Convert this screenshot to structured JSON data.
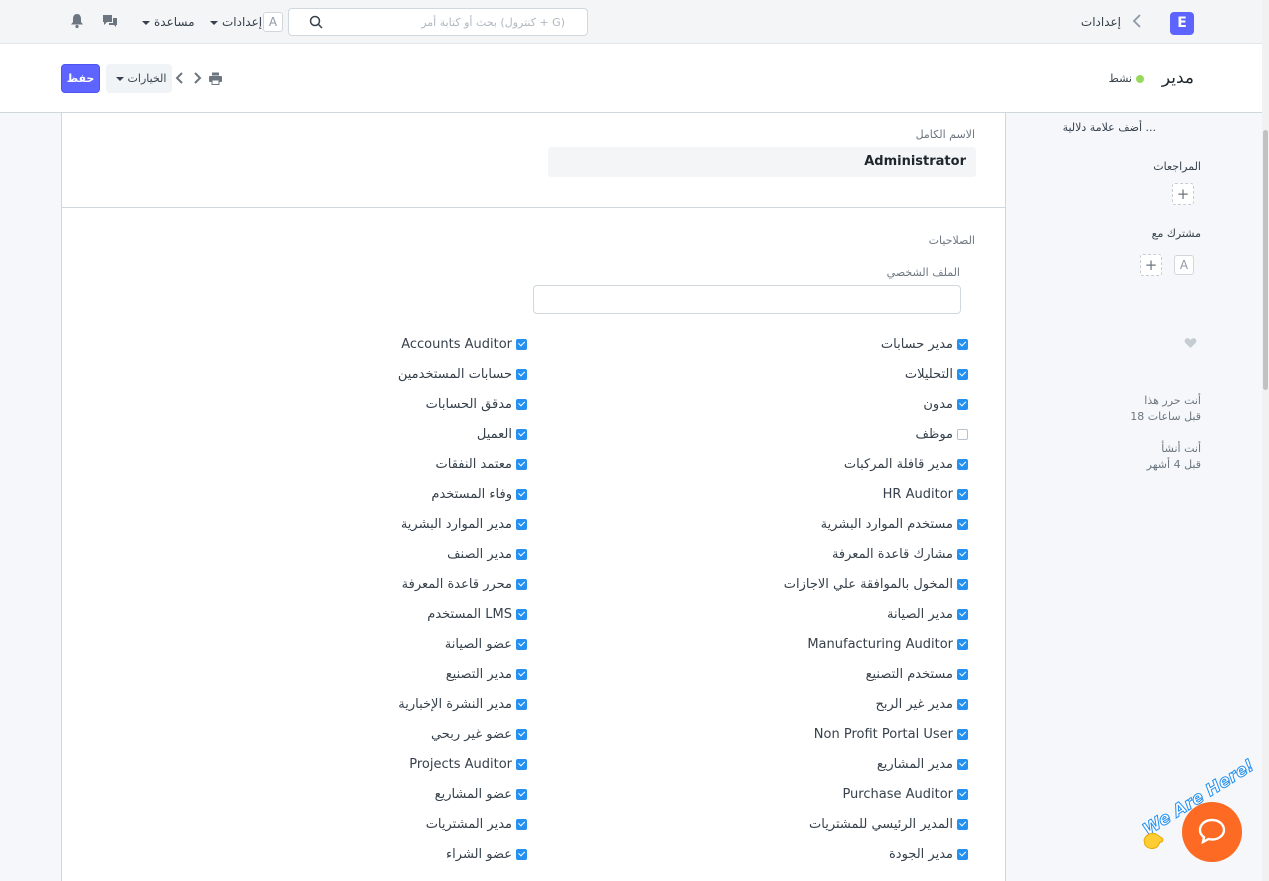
{
  "navbar": {
    "brand_letter": "E",
    "breadcrumb": "إعدادات",
    "search_placeholder": "بحث أو كتابة أمر (كنترول + G)",
    "avatar_letter": "A",
    "settings_menu": "إعدادات",
    "help_menu": "مساعدة"
  },
  "page": {
    "title": "مدير",
    "status": "نشط",
    "save_label": "حفظ",
    "options_label": "الخيارات"
  },
  "sidebar": {
    "add_tag": "أضف علامة دلالية ...",
    "reviews_label": "المراجعات",
    "shared_with_label": "مشترك مع",
    "shared_avatar": "A",
    "activity_1_line1": "أنت حرر هذا",
    "activity_1_line2": "18 قبل ساعات",
    "activity_2_line1": "أنت أنشأ",
    "activity_2_line2": "قبل 4 أشهر"
  },
  "form": {
    "full_name_label": "الاسم الكامل",
    "full_name_value": "Administrator",
    "permissions_section": "الصلاحيات",
    "profile_label": "الملف الشخصي"
  },
  "roles_right": [
    {
      "label": "مدير حسابات",
      "checked": true
    },
    {
      "label": "التحليلات",
      "checked": true
    },
    {
      "label": "مدون",
      "checked": true
    },
    {
      "label": "موظف",
      "checked": false
    },
    {
      "label": "مدير قافلة المركبات",
      "checked": true
    },
    {
      "label": "HR Auditor",
      "checked": true
    },
    {
      "label": "مستخدم الموارد البشرية",
      "checked": true
    },
    {
      "label": "مشارك قاعدة المعرفة",
      "checked": true
    },
    {
      "label": "المخول بالموافقة علي الاجازات",
      "checked": true
    },
    {
      "label": "مدير الصيانة",
      "checked": true
    },
    {
      "label": "Manufacturing Auditor",
      "checked": true
    },
    {
      "label": "مستخدم التصنيع",
      "checked": true
    },
    {
      "label": "مدير غير الربح",
      "checked": true
    },
    {
      "label": "Non Profit Portal User",
      "checked": true
    },
    {
      "label": "مدير المشاريع",
      "checked": true
    },
    {
      "label": "Purchase Auditor",
      "checked": true
    },
    {
      "label": "المدير الرئيسي للمشتريات",
      "checked": true
    },
    {
      "label": "مدير الجودة",
      "checked": true
    }
  ],
  "roles_left": [
    {
      "label": "Accounts Auditor",
      "checked": true
    },
    {
      "label": "حسابات المستخدمين",
      "checked": true
    },
    {
      "label": "مدقق الحسابات",
      "checked": true
    },
    {
      "label": "العميل",
      "checked": true
    },
    {
      "label": "معتمد النفقات",
      "checked": true
    },
    {
      "label": "وفاء المستخدم",
      "checked": true
    },
    {
      "label": "مدير الموارد البشرية",
      "checked": true
    },
    {
      "label": "مدير الصنف",
      "checked": true
    },
    {
      "label": "محرر قاعدة المعرفة",
      "checked": true
    },
    {
      "label": "LMS المستخدم",
      "checked": true
    },
    {
      "label": "عضو الصيانة",
      "checked": true
    },
    {
      "label": "مدير التصنيع",
      "checked": true
    },
    {
      "label": "مدير النشرة الإخبارية",
      "checked": true
    },
    {
      "label": "عضو غير ربحي",
      "checked": true
    },
    {
      "label": "Projects Auditor",
      "checked": true
    },
    {
      "label": "عضو المشاريع",
      "checked": true
    },
    {
      "label": "مدير المشتريات",
      "checked": true
    },
    {
      "label": "عضو الشراء",
      "checked": true
    }
  ],
  "chat": {
    "tagline": "We Are Here!"
  },
  "colors": {
    "primary": "#5e64ff",
    "checkbox": "#2490ef",
    "status_dot": "#98d85b",
    "chat": "#fc6a23"
  }
}
